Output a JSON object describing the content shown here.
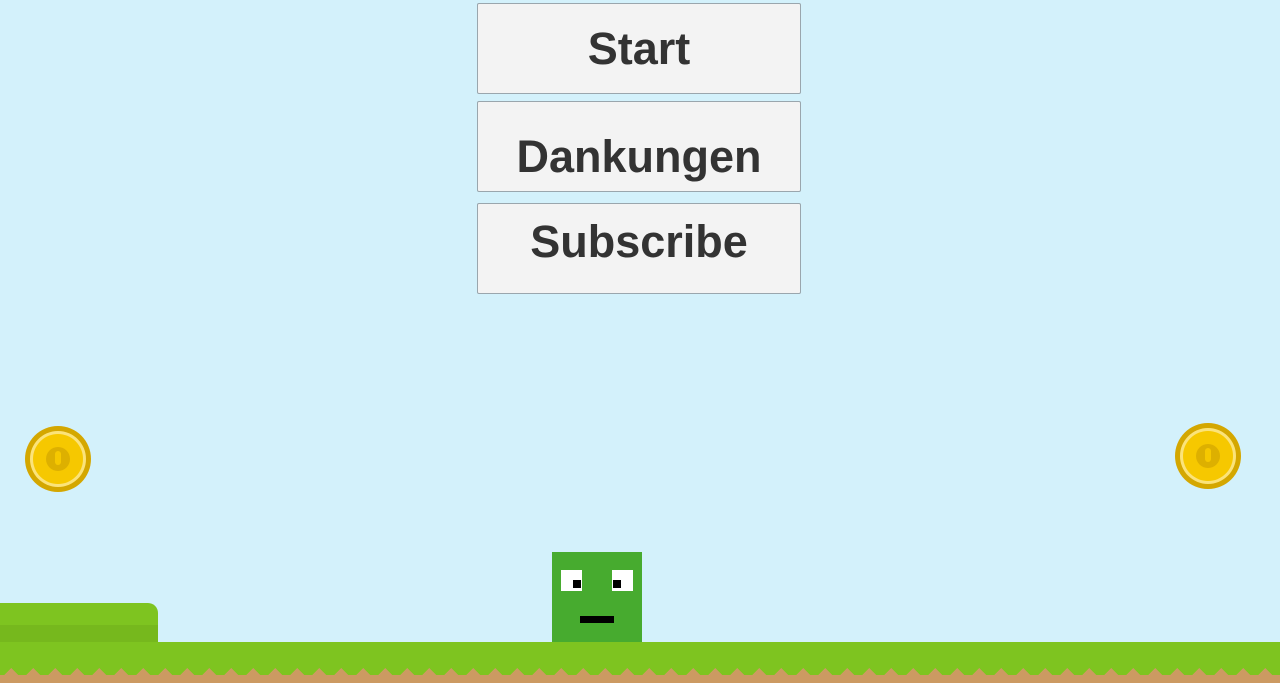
{
  "menu": {
    "start_label": "Start",
    "credits_label": "Dankungen",
    "subscribe_label": "Subscribe"
  },
  "colors": {
    "sky": "#d3f1fb",
    "button_bg": "#f3f3f3",
    "button_text": "#333333",
    "player": "#47ab2f",
    "grass": "#7ec420",
    "dirt": "#cc9a62",
    "coin": "#f6c800"
  },
  "scene": {
    "coins": [
      "coin-icon",
      "coin-icon"
    ],
    "player": "green-square-character"
  }
}
